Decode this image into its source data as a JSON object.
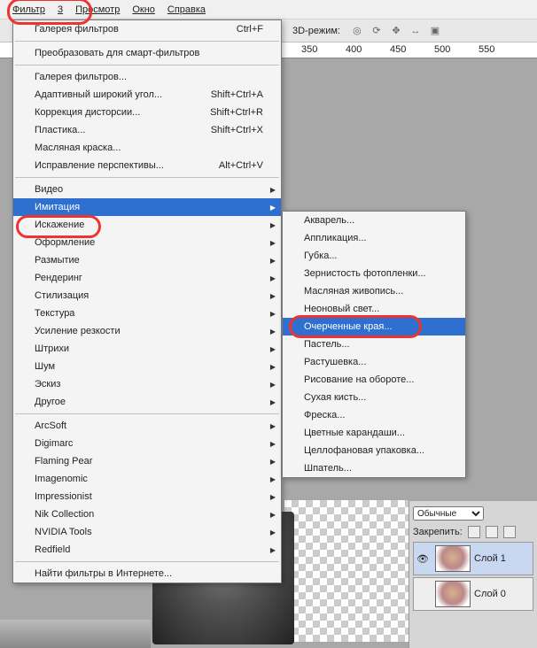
{
  "menubar": {
    "filter": "Фильтр",
    "threeD": "3",
    "view": "Просмотр",
    "window": "Окно",
    "help": "Справка"
  },
  "toolbar": {
    "mode_label": "3D-режим:"
  },
  "ruler": {
    "t1": "350",
    "t2": "400",
    "t3": "450",
    "t4": "500",
    "t5": "550"
  },
  "menu": {
    "gallery": "Галерея фильтров",
    "gallery_sc": "Ctrl+F",
    "smart": "Преобразовать для смарт-фильтров",
    "gallery2": "Галерея фильтров...",
    "adaptive": "Адаптивный широкий угол...",
    "adaptive_sc": "Shift+Ctrl+A",
    "lens": "Коррекция дисторсии...",
    "lens_sc": "Shift+Ctrl+R",
    "liquify": "Пластика...",
    "liquify_sc": "Shift+Ctrl+X",
    "oil": "Масляная краска...",
    "vanish": "Исправление перспективы...",
    "vanish_sc": "Alt+Ctrl+V",
    "video": "Видео",
    "imit": "Имитация",
    "distort": "Искажение",
    "pixelate": "Оформление",
    "blur": "Размытие",
    "render": "Рендеринг",
    "stylize": "Стилизация",
    "texture": "Текстура",
    "sharpen": "Усиление резкости",
    "strokes": "Штрихи",
    "noise": "Шум",
    "sketch": "Эскиз",
    "other": "Другое",
    "arcsoft": "ArcSoft",
    "digimarc": "Digimarc",
    "flaming": "Flaming Pear",
    "imagenomic": "Imagenomic",
    "impressionist": "Impressionist",
    "nik": "Nik Collection",
    "nvidia": "NVIDIA Tools",
    "redfield": "Redfield",
    "browse": "Найти фильтры в Интернете..."
  },
  "sub": {
    "watercolor": "Акварель...",
    "cutout": "Аппликация...",
    "sponge": "Губка...",
    "grain": "Зернистость фотопленки...",
    "oilpaint": "Масляная живопись...",
    "neon": "Неоновый свет...",
    "poster": "Очерченные края...",
    "pastel": "Пастель...",
    "smudge": "Растушевка...",
    "underpaint": "Рисование на обороте...",
    "drybrush": "Сухая кисть...",
    "fresco": "Фреска...",
    "pencil": "Цветные карандаши...",
    "plastic": "Целлофановая упаковка...",
    "palette": "Шпатель..."
  },
  "panel": {
    "blend": "Обычные",
    "lock": "Закрепить:",
    "layer1": "Слой 1",
    "layer0": "Слой 0"
  }
}
